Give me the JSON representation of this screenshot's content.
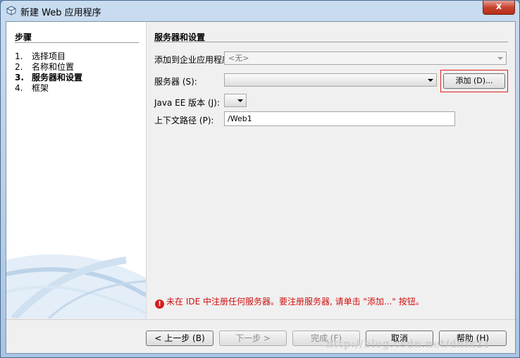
{
  "window": {
    "title": "新建 Web 应用程序",
    "close_label": "x"
  },
  "steps": {
    "title": "步骤",
    "items": [
      {
        "num": "1.",
        "label": "选择项目"
      },
      {
        "num": "2.",
        "label": "名称和位置"
      },
      {
        "num": "3.",
        "label": "服务器和设置"
      },
      {
        "num": "4.",
        "label": "框架"
      }
    ]
  },
  "form": {
    "section_title": "服务器和设置",
    "enterprise_label": "添加到企业应用程序 (A):",
    "enterprise_value": "<无>",
    "server_label": "服务器 (S):",
    "server_value": "",
    "add_button": "添加 (D)...",
    "javaee_label": "Java EE 版本 (J):",
    "javaee_value": "",
    "context_label": "上下文路径 (P):",
    "context_value": "/Web1"
  },
  "error": {
    "icon": "error-icon",
    "message": "未在 IDE 中注册任何服务器。要注册服务器, 请单击 \"添加...\" 按钮。"
  },
  "buttons": {
    "back": "< 上一步 (B)",
    "next": "下一步 >",
    "finish": "完成 (F)",
    "cancel": "取消",
    "help": "帮助 (H)"
  },
  "watermark": "http://blog.csdn.net/dnfx21"
}
